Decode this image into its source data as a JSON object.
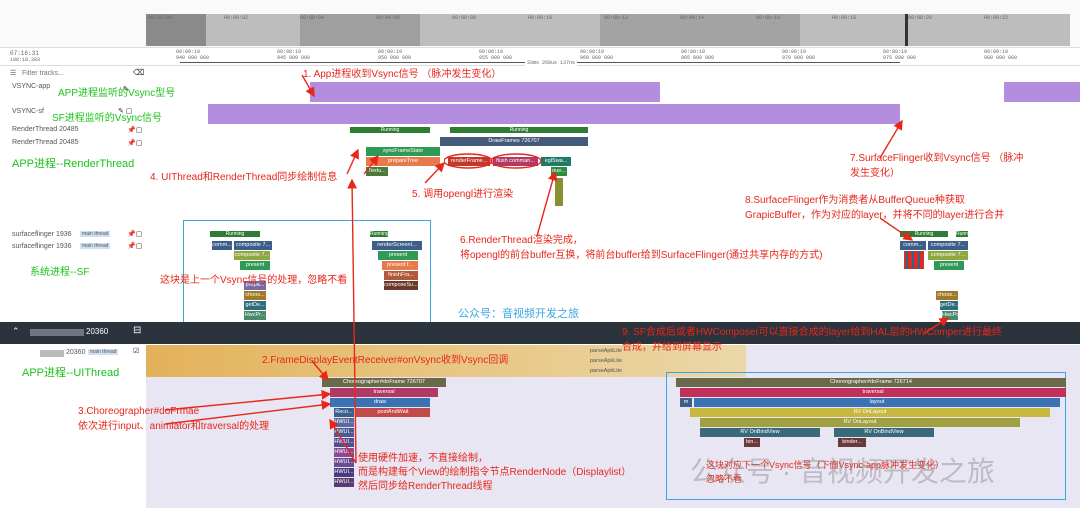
{
  "ruler": {
    "time_ticks": [
      "00:00:00",
      "00:00:02",
      "00:00:04",
      "00:00:06",
      "00:00:08",
      "00:00:10",
      "00:00:12",
      "00:00:14",
      "00:00:16",
      "00:00:18",
      "00:00:20",
      "00:00:22"
    ],
    "start_time": "07:16:31",
    "start_time_sub": "100:10.393",
    "detail_ticks": [
      "00:00:19\n940 000 000",
      "00:00:19\n945 000 000",
      "00:00:19\n950 000 000",
      "00:00:19\n955 000 000",
      "00:00:19\n960 000 000",
      "00:00:19\n965 000 000",
      "00:00:19\n970 000 000",
      "00:00:19\n975 000 000",
      "00:00:19\n980 000 000"
    ],
    "span_label": "33ms 268us 137ns"
  },
  "filter": {
    "placeholder": "Filter tracks..."
  },
  "tracks": {
    "vsync_app": "VSYNC-app",
    "vsync_sf": "VSYNC-sf",
    "render_thread_1": "RenderThread 20485",
    "render_thread_2": "RenderThread 20485",
    "sf_1": "surfaceflinger 1936",
    "sf_2": "surfaceflinger 1936",
    "main_thread_tag": "main thread",
    "process_header": "20360",
    "ui_thread": "20360",
    "ui_thread_tag": "main thread"
  },
  "slices": {
    "running": "Running",
    "draw_frames": "DrawFrames 726707",
    "sync_frame_state": "syncFrameState",
    "prepare_tree": "prepareTree",
    "text": "Textu...",
    "render_frame": "renderFrame...",
    "flush_command": "flush comman...",
    "eglswap": "eglSwa...",
    "que": "que...",
    "composite": "composite 7...",
    "composite2": "composite 7...",
    "present": "present",
    "prepare": "prepa...",
    "choos": "choos...",
    "getde": "getDe...",
    "hwcpr": "HwcPr...",
    "comm": "comm...",
    "render_screen": "renderScreenI...",
    "present_f": "present f...",
    "finish_fra": "finishFra...",
    "compose_su": "composeSu...",
    "choreo_1": "Choreographer#doFrame 726707",
    "traversal": "traversal",
    "draw": "draw",
    "record": "Reco...",
    "post_and_wait": "postAndWait",
    "hwui": "HWUI...",
    "choreo_2": "Choreographer#doFrame 726714",
    "layout": "layout",
    "rv_onlayout": "RV OnLayout",
    "rv_onlayout2": "RV OnLayout",
    "rv_onbindview": "RV OnBindView",
    "rv_onbindview2": "RV OnBindView",
    "bin": "bin...",
    "binder": "binder...",
    "parse_apk": "parseApkLite"
  },
  "notes": {
    "app_vsync": "APP进程监听的Vsync型号",
    "sf_vsync": "SF进程监听的Vsync信号",
    "app_render": "APP进程--RenderThread",
    "sys_sf": "系统进程--SF",
    "app_ui": "APP进程--UIThread",
    "ignore": "这块是上一个Vsync信号的处理，忽略不看",
    "gongzhonghao": "公众号：音视频开发之旅",
    "n1": "1. App进程收到Vsync信号 （脉冲发生变化）",
    "n2": "2.FrameDisplayEventReceiver#onVsync收到Vsync回调",
    "n3a": "3.Choreographer#doFrmae",
    "n3b": "依次进行input、animiator和traversal的处理",
    "n4": "4. UIThread和RenderThread同步绘制信息",
    "n5": "5. 调用opengl进行渲染",
    "n6a": "6.RenderThread渲染完成，",
    "n6b": "将opengl的前台buffer互换，将前台buffer给到SurfaceFlinger(通过共享内存的方式)",
    "n7a": "7.SurfaceFlinger收到Vsync信号 （脉冲",
    "n7b": "发生变化）",
    "n8a": "8.SurfaceFlinger作为消费者从BufferQueue种获取",
    "n8b": "GrapicBuffer，作为对应的layer，并将不同的layer进行合并",
    "n9a": "9. SF合成后或者HWComposer可以直接合成的layer给到HAL层的HWComper进行最终",
    "n9b": "合成，并给到屏幕显示",
    "hw_a": "使用硬件加速，不直接绘制，",
    "hw_b": "而是构建每个View的绘制指令节点RenderNode（Displaylist）",
    "hw_c": "然后同步给RenderThread线程",
    "next_ignore_a": "这块对应下一个Vsync信号（下面Vsync-app脉冲发生变化）",
    "next_ignore_b": "忽略不看",
    "watermark": "公众号 · 音视频开发之旅"
  },
  "colors": {
    "vsync_purple": "#b48ede",
    "running_green": "#2e7d32",
    "annotation_red": "#e8261a",
    "note_green": "#19c219",
    "box_blue": "#3aa6e0"
  }
}
